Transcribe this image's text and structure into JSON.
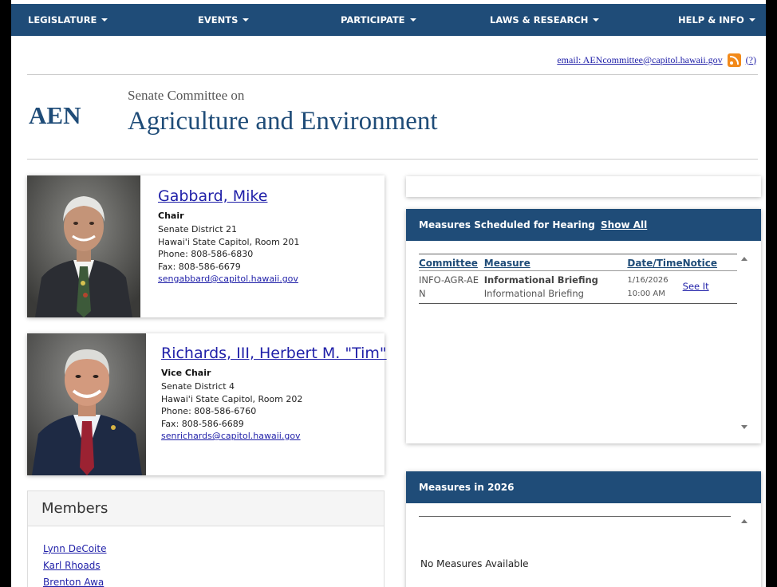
{
  "nav": {
    "items": [
      "LEGISLATURE",
      "EVENTS",
      "PARTICIPATE",
      "LAWS & RESEARCH",
      "HELP & INFO"
    ]
  },
  "contact": {
    "email_link": "email: AENcommittee@capitol.hawaii.gov",
    "help_link": "(?)"
  },
  "committee": {
    "abbr": "AEN",
    "subtitle": "Senate Committee on",
    "title": "Agriculture and Environment"
  },
  "chair": {
    "name": "Gabbard, Mike",
    "role": "Chair",
    "district": "Senate District 21",
    "room": "Hawai'i State Capitol, Room 201",
    "phone": "Phone: 808-586-6830",
    "fax": "Fax: 808-586-6679",
    "email": "sengabbard@capitol.hawaii.gov"
  },
  "vice_chair": {
    "name": "Richards, III, Herbert M. \"Tim\"",
    "role": "Vice Chair",
    "district": "Senate District 4",
    "room": "Hawai'i State Capitol, Room 202",
    "phone": "Phone: 808-586-6760",
    "fax": "Fax: 808-586-6689",
    "email": "senrichards@capitol.hawaii.gov"
  },
  "members": {
    "heading": "Members",
    "list": [
      "Lynn DeCoite",
      "Karl Rhoads",
      "Brenton Awa"
    ]
  },
  "hearings": {
    "heading": "Measures Scheduled for Hearing",
    "show_all": "Show All",
    "columns": [
      "Committee",
      "Measure",
      "Date/Time",
      "Notice"
    ],
    "rows": [
      {
        "committee": "INFO-AGR-AEN",
        "measure_title": "Informational Briefing",
        "measure_desc": "Informational Briefing",
        "date": "1/16/2026",
        "time": "10:00 AM",
        "notice": "See It"
      }
    ]
  },
  "measures_year": {
    "heading": "Measures in 2026",
    "empty_text": "No Measures Available"
  },
  "colors": {
    "nav_bg": "#1f4c78",
    "link": "#1f1fa8",
    "rss": "#f28a1b"
  }
}
